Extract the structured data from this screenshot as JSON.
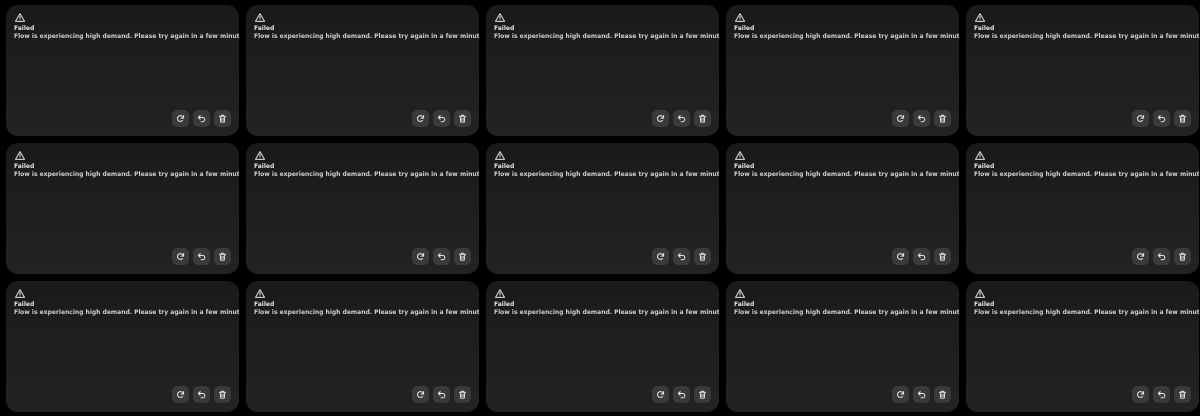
{
  "cards": [
    {
      "title": "Failed",
      "message": "Flow is experiencing high demand. Please try again in a few minutes."
    },
    {
      "title": "Failed",
      "message": "Flow is experiencing high demand. Please try again in a few minutes."
    },
    {
      "title": "Failed",
      "message": "Flow is experiencing high demand. Please try again in a few minutes."
    },
    {
      "title": "Failed",
      "message": "Flow is experiencing high demand. Please try again in a few minutes."
    },
    {
      "title": "Failed",
      "message": "Flow is experiencing high demand. Please try again in a few minutes."
    },
    {
      "title": "Failed",
      "message": "Flow is experiencing high demand. Please try again in a few minutes."
    },
    {
      "title": "Failed",
      "message": "Flow is experiencing high demand. Please try again in a few minutes."
    },
    {
      "title": "Failed",
      "message": "Flow is experiencing high demand. Please try again in a few minutes."
    },
    {
      "title": "Failed",
      "message": "Flow is experiencing high demand. Please try again in a few minutes."
    },
    {
      "title": "Failed",
      "message": "Flow is experiencing high demand. Please try again in a few minutes."
    },
    {
      "title": "Failed",
      "message": "Flow is experiencing high demand. Please try again in a few minutes."
    },
    {
      "title": "Failed",
      "message": "Flow is experiencing high demand. Please try again in a few minutes."
    },
    {
      "title": "Failed",
      "message": "Flow is experiencing high demand. Please try again in a few minutes."
    },
    {
      "title": "Failed",
      "message": "Flow is experiencing high demand. Please try again in a few minutes."
    },
    {
      "title": "Failed",
      "message": "Flow is experiencing high demand. Please try again in a few minutes."
    }
  ],
  "icons": {
    "status": "warning-triangle-icon",
    "retry": "refresh-icon",
    "undo": "undo-icon",
    "delete": "trash-icon"
  },
  "colors": {
    "page_background": "#000000",
    "card_background": "#1e1e1e",
    "button_background": "#3a3a3a",
    "text_primary": "#e6e6e6",
    "icon": "#e0e0e0"
  }
}
